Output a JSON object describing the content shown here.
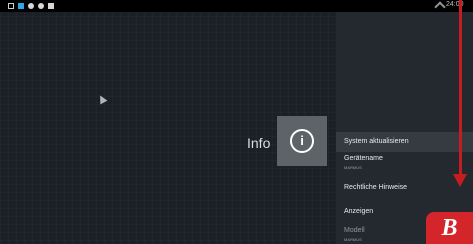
{
  "statusbar": {
    "clock": "24:00",
    "icons": [
      "square-icon",
      "app-icon",
      "circle-icon",
      "circle-icon",
      "square-icon"
    ]
  },
  "main": {
    "info_label": "Info",
    "info_icon": "i"
  },
  "settings": {
    "items": [
      {
        "label": "System aktualisieren",
        "subtitle": ""
      },
      {
        "label": "Gerätename",
        "subtitle": "MARMUS"
      },
      {
        "label": "Rechtliche Hinweise",
        "subtitle": ""
      },
      {
        "label": "Anzeigen",
        "subtitle": ""
      },
      {
        "label": "Modell",
        "subtitle": "MARMUS"
      }
    ]
  },
  "overlay": {
    "badge_letter": "B"
  }
}
